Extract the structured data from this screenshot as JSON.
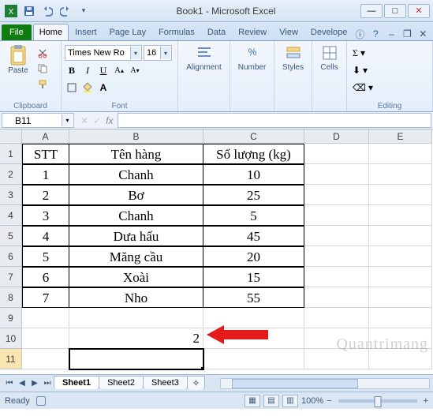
{
  "window": {
    "title": "Book1 - Microsoft Excel",
    "min": "—",
    "max": "□",
    "close": "✕"
  },
  "tabs": {
    "file": "File",
    "items": [
      "Home",
      "Insert",
      "Page Lay",
      "Formulas",
      "Data",
      "Review",
      "View",
      "Develope"
    ],
    "active": "Home"
  },
  "ribbon": {
    "clipboard": {
      "label": "Clipboard",
      "paste": "Paste"
    },
    "font": {
      "label": "Font",
      "name": "Times New Ro",
      "size": "16",
      "b": "B",
      "i": "I",
      "u": "U"
    },
    "alignment": {
      "label": "Alignment"
    },
    "number": {
      "label": "Number"
    },
    "styles": {
      "label": "Styles"
    },
    "cells": {
      "label": "Cells"
    },
    "editing": {
      "label": "Editing"
    }
  },
  "namebox": "B11",
  "fx": "fx",
  "cols": [
    "A",
    "B",
    "C",
    "D",
    "E"
  ],
  "table": {
    "headers": {
      "stt": "STT",
      "name": "Tên hàng",
      "qty": "Số lượng (kg)"
    },
    "rows": [
      {
        "stt": "1",
        "name": "Chanh",
        "qty": "10"
      },
      {
        "stt": "2",
        "name": "Bơ",
        "qty": "25"
      },
      {
        "stt": "3",
        "name": "Chanh",
        "qty": "5"
      },
      {
        "stt": "4",
        "name": "Dưa hấu",
        "qty": "45"
      },
      {
        "stt": "5",
        "name": "Măng cầu",
        "qty": "20"
      },
      {
        "stt": "6",
        "name": "Xoài",
        "qty": "15"
      },
      {
        "stt": "7",
        "name": "Nho",
        "qty": "55"
      }
    ]
  },
  "b10": "2",
  "sheets": {
    "items": [
      "Sheet1",
      "Sheet2",
      "Sheet3"
    ],
    "active": "Sheet1"
  },
  "status": {
    "ready": "Ready",
    "zoom": "100%"
  },
  "watermark": "Quantrimang"
}
